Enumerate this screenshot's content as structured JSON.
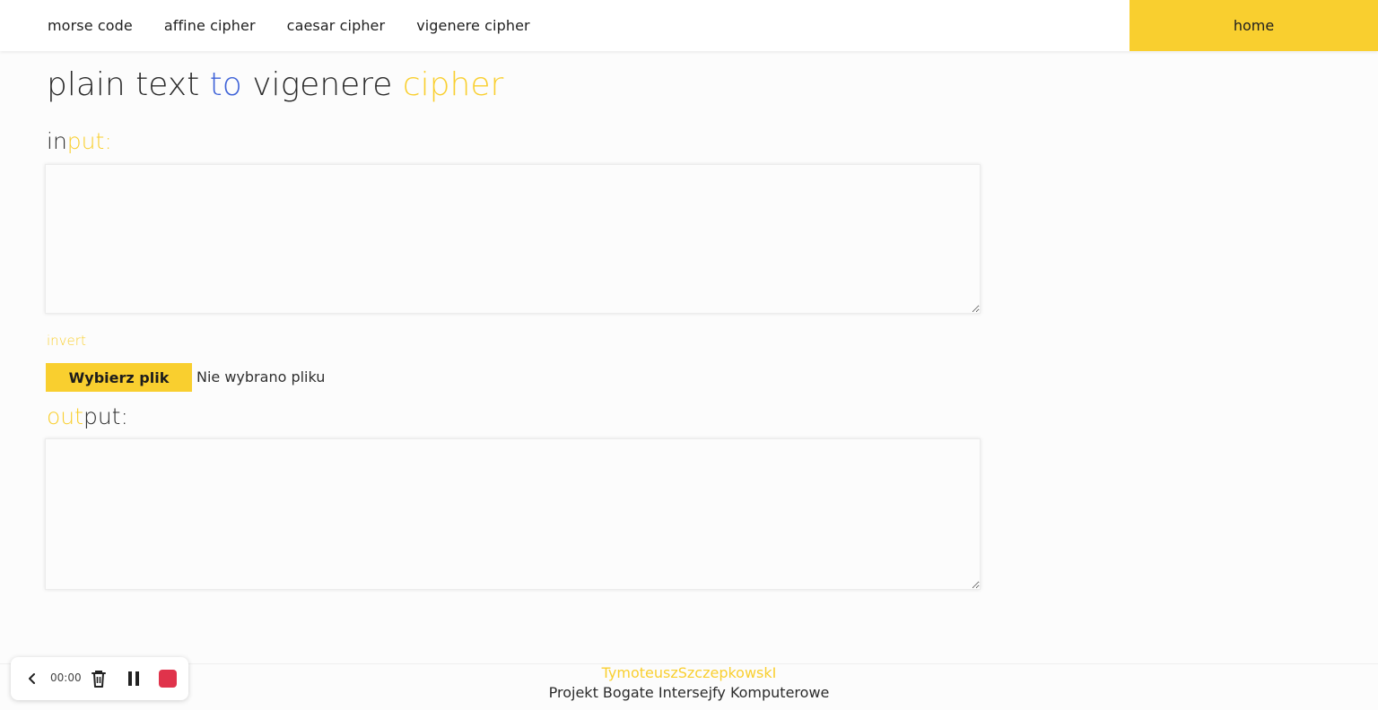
{
  "colors": {
    "accent": "#f9cf2f",
    "blue": "#3f63d8",
    "text": "#2b2b2b",
    "stop": "#e0334b"
  },
  "nav": {
    "links": [
      "morse code",
      "affine cipher",
      "caesar cipher",
      "vigenere cipher"
    ],
    "home": "home"
  },
  "title": {
    "part1": "plain text ",
    "part2": "to",
    "part3": " vigenere ",
    "part4": "cipher"
  },
  "input": {
    "label_a": "in",
    "label_b": "put:",
    "value": "",
    "placeholder": ""
  },
  "invert": "invert",
  "file": {
    "button": "Wybierz plik",
    "status": "Nie wybrano pliku"
  },
  "output": {
    "label_a": "out",
    "label_b": "put:",
    "value": ""
  },
  "footer": {
    "author": "TymoteuszSzczepkowskI",
    "project": "Projekt Bogate Intersejfy Komputerowe"
  },
  "recorder": {
    "time": "00:00",
    "icons": [
      "chevron-left-icon",
      "trash-icon",
      "pause-icon",
      "stop-icon"
    ]
  }
}
